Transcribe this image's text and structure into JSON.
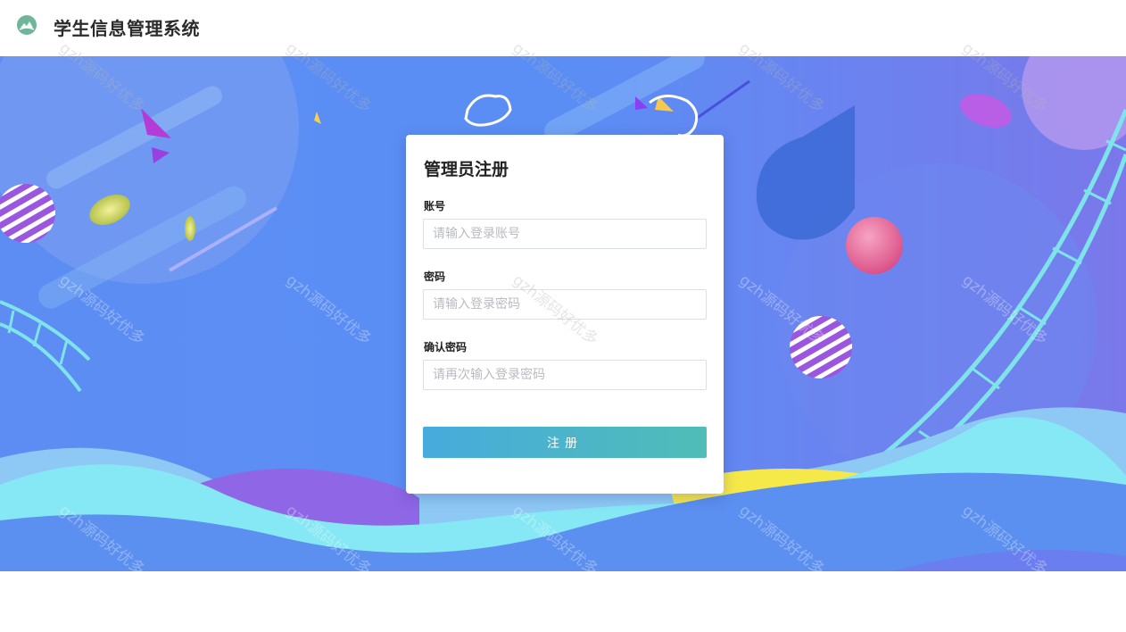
{
  "header": {
    "title": "学生信息管理系统",
    "logo_icon": "mountain-logo-icon"
  },
  "form": {
    "title": "管理员注册",
    "fields": [
      {
        "label": "账号",
        "placeholder": "请输入登录账号",
        "value": ""
      },
      {
        "label": "密码",
        "placeholder": "请输入登录密码",
        "value": ""
      },
      {
        "label": "确认密码",
        "placeholder": "请再次输入登录密码",
        "value": ""
      }
    ],
    "submit_label": "注册"
  },
  "watermark": {
    "text": "gzh源码好优多"
  },
  "colors": {
    "button_start": "#47abdc",
    "button_end": "#50bdb7",
    "banner_bg": "#5b8ff0"
  }
}
